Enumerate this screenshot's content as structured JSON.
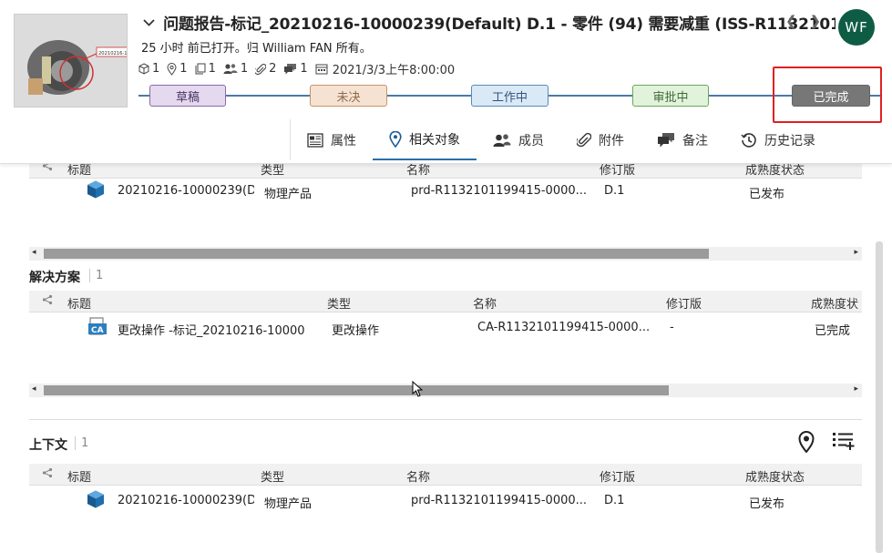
{
  "header": {
    "title": "问题报告-标记_20210216-10000239(Default) D.1 - 零件 (94) 需要减重 (ISS-R1132101...",
    "subline": "25 小时 前已打开。归 William FAN 所有。",
    "avatar": "WF",
    "nav_prev": "❮",
    "nav_next": "❯",
    "stats": [
      {
        "icon": "cube-icon",
        "value": "1"
      },
      {
        "icon": "pin-icon",
        "value": "1"
      },
      {
        "icon": "pages-icon",
        "value": "1"
      },
      {
        "icon": "people-icon",
        "value": "1"
      },
      {
        "icon": "paperclip-icon",
        "value": "2"
      },
      {
        "icon": "comment-icon",
        "value": "1"
      }
    ],
    "date": "2021/3/3上午8:00:00",
    "stages": [
      "草稿",
      "未决",
      "工作中",
      "审批中",
      "已完成"
    ],
    "thumb_label": "20210216-10000"
  },
  "tabs": [
    {
      "label": "属性",
      "icon": "properties-icon"
    },
    {
      "label": "相关对象",
      "icon": "location-pin-icon",
      "active": true
    },
    {
      "label": "成员",
      "icon": "members-icon"
    },
    {
      "label": "附件",
      "icon": "attachment-icon"
    },
    {
      "label": "备注",
      "icon": "notes-icon"
    },
    {
      "label": "历史记录",
      "icon": "history-icon"
    }
  ],
  "grid1": {
    "columns": [
      "标题",
      "类型",
      "名称",
      "修订版",
      "成熟度状态"
    ],
    "rows": [
      {
        "title": "20210216-10000239(D",
        "type": "物理产品",
        "name": "prd-R1132101199415-0000...",
        "rev": "D.1",
        "status": "已发布"
      }
    ]
  },
  "solutions": {
    "title": "解决方案",
    "count": "1",
    "columns": [
      "标题",
      "类型",
      "名称",
      "修订版",
      "成熟度状"
    ],
    "rows": [
      {
        "title": "更改操作 -标记_20210216-10000",
        "type": "更改操作",
        "name": "CA-R1132101199415-0000...",
        "rev": "-",
        "status": "已完成"
      }
    ]
  },
  "context": {
    "title": "上下文",
    "count": "1",
    "columns": [
      "标题",
      "类型",
      "名称",
      "修订版",
      "成熟度状态"
    ],
    "rows": [
      {
        "title": "20210216-10000239(D",
        "type": "物理产品",
        "name": "prd-R1132101199415-0000...",
        "rev": "D.1",
        "status": "已发布"
      }
    ]
  },
  "scroll_arrows": {
    "left": "◂",
    "right": "▸"
  }
}
